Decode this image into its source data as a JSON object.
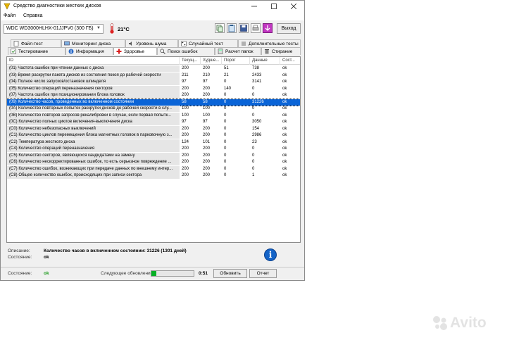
{
  "window": {
    "title": "Средство диагностики жестких дисков"
  },
  "menu": [
    "Файл",
    "Справка"
  ],
  "toolbar": {
    "drive": "WDC WD3000HLHX-01JJPV0 (300 ГБ)",
    "temperature": "21°C",
    "exit_label": "Выход"
  },
  "tabs_top": [
    "Файл-тест",
    "Мониторинг диска",
    "Уровень шума",
    "Случайный тест",
    "Дополнительные тесты"
  ],
  "tabs_bottom": [
    "Тестирование",
    "Информация",
    "Здоровье",
    "Поиск ошибок",
    "Расчет папок",
    "Стирание"
  ],
  "active_tab": "Здоровье",
  "columns": [
    "ID",
    "Текущ...",
    "Худше...",
    "Порог",
    "Данные",
    "Сост..."
  ],
  "rows": [
    [
      "(01) Частота ошибок при чтении данных с диска",
      "200",
      "200",
      "51",
      "738",
      "ok"
    ],
    [
      "(03) Время раскрутки пакета дисков из состояния покоя до рабочей скорости",
      "211",
      "210",
      "21",
      "2433",
      "ok"
    ],
    [
      "(04) Полное число запусков/остановок шпинделя",
      "97",
      "97",
      "0",
      "3141",
      "ok"
    ],
    [
      "(05) Количество операций переназначения секторов",
      "200",
      "200",
      "140",
      "0",
      "ok"
    ],
    [
      "(07) Частота ошибок при позиционировании блока головок",
      "200",
      "200",
      "0",
      "0",
      "ok"
    ],
    [
      "(09) Количество часов, проведенных во включенном состоянии",
      "58",
      "58",
      "0",
      "31226",
      "ok"
    ],
    [
      "(0A) Количество повторных попыток раскрутки дисков до рабочей скорости в слу...",
      "100",
      "100",
      "0",
      "0",
      "ok"
    ],
    [
      "(0B) Количество повторов запросов рекалибровки в случае, если первая попытк...",
      "100",
      "100",
      "0",
      "0",
      "ok"
    ],
    [
      "(0C) Количество полных циклов включения-выключения диска",
      "97",
      "97",
      "0",
      "3050",
      "ok"
    ],
    [
      "(C0) Количество небезопасных выключений",
      "200",
      "200",
      "0",
      "154",
      "ok"
    ],
    [
      "(C1) Количество циклов перемещения блока магнитных головок в парковочную з...",
      "200",
      "200",
      "0",
      "2986",
      "ok"
    ],
    [
      "(C2) Температура жесткого диска",
      "124",
      "101",
      "0",
      "23",
      "ok"
    ],
    [
      "(C4) Количество операций переназначения",
      "200",
      "200",
      "0",
      "0",
      "ok"
    ],
    [
      "(C5) Количество секторов, являющихся кандидатами на замену",
      "200",
      "200",
      "0",
      "0",
      "ok"
    ],
    [
      "(C6) Количество нескорректированных ошибок, то есть серьезное повреждение ...",
      "200",
      "200",
      "0",
      "0",
      "ok"
    ],
    [
      "(C7) Количество ошибок, возникающих при передаче данных по внешнему интер...",
      "200",
      "200",
      "0",
      "0",
      "ok"
    ],
    [
      "(C8) Общее количество ошибок, происходящих при записи сектора",
      "200",
      "200",
      "0",
      "1",
      "ok"
    ]
  ],
  "selected_row": 5,
  "description": {
    "desc_label": "Описание:",
    "desc_value": "Количество часов в включенном состоянии: 31226 (1301 дней)",
    "state_label": "Состояние:",
    "state_value": "ok"
  },
  "status": {
    "state_label": "Состояние:",
    "state_value": "ok",
    "next_update_label": "Следующее обновление:",
    "countdown": "0:51",
    "progress": 0.12,
    "refresh_label": "Обновить",
    "report_label": "Отчет"
  },
  "watermark": {
    "text": "Avito"
  },
  "colors": {
    "selection": "#0a64d7",
    "ok_green": "#1a9a1a",
    "progress": "#06b025",
    "info": "#1464c8"
  }
}
